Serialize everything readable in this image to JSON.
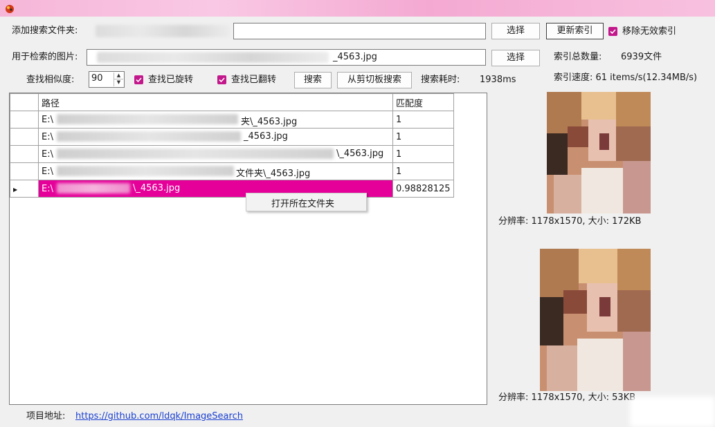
{
  "labels": {
    "add_folder": "添加搜索文件夹:",
    "search_image": "用于检索的图片:",
    "similarity": "查找相似度:",
    "index_total_label": "索引总数量:",
    "index_speed": "索引速度: 61 items/s(12.34MB/s)",
    "search_time_label": "搜索耗时:",
    "project_label": "项目地址:"
  },
  "inputs": {
    "folder_path": "",
    "image_path_suffix": "_4563.jpg",
    "similarity_value": "90"
  },
  "buttons": {
    "select1": "选择",
    "select2": "选择",
    "update_index": "更新索引",
    "search": "搜索",
    "clipboard_search": "从剪切板搜索"
  },
  "checkboxes": {
    "remove_invalid": "移除无效索引",
    "find_rotated": "查找已旋转",
    "find_flipped": "查找已翻转"
  },
  "stats": {
    "index_total": "6939文件",
    "search_time": "1938ms"
  },
  "table": {
    "columns": [
      "路径",
      "匹配度"
    ],
    "rows": [
      {
        "prefix": "E:\\",
        "suffix": "夹\\_4563.jpg",
        "score": "1"
      },
      {
        "prefix": "E:\\",
        "suffix": "_4563.jpg",
        "score": "1"
      },
      {
        "prefix": "E:\\",
        "suffix": "\\_4563.jpg",
        "score": "1"
      },
      {
        "prefix": "E:\\",
        "suffix": "文件夹\\_4563.jpg",
        "score": "1"
      },
      {
        "prefix": "E:\\",
        "suffix": "\\_4563.jpg",
        "score": "0.98828125"
      }
    ]
  },
  "context_menu": {
    "open_folder": "打开所在文件夹"
  },
  "previews": {
    "top_info": "分辨率: 1178x1570, 大小: 172KB",
    "bottom_info": "分辨率: 1178x1570, 大小: 53KB"
  },
  "footer": {
    "url": "https://github.com/ldqk/ImageSearch"
  },
  "colors": {
    "accent": "#e6009a",
    "checkbox": "#c2188b",
    "link": "#1a3fd1"
  }
}
